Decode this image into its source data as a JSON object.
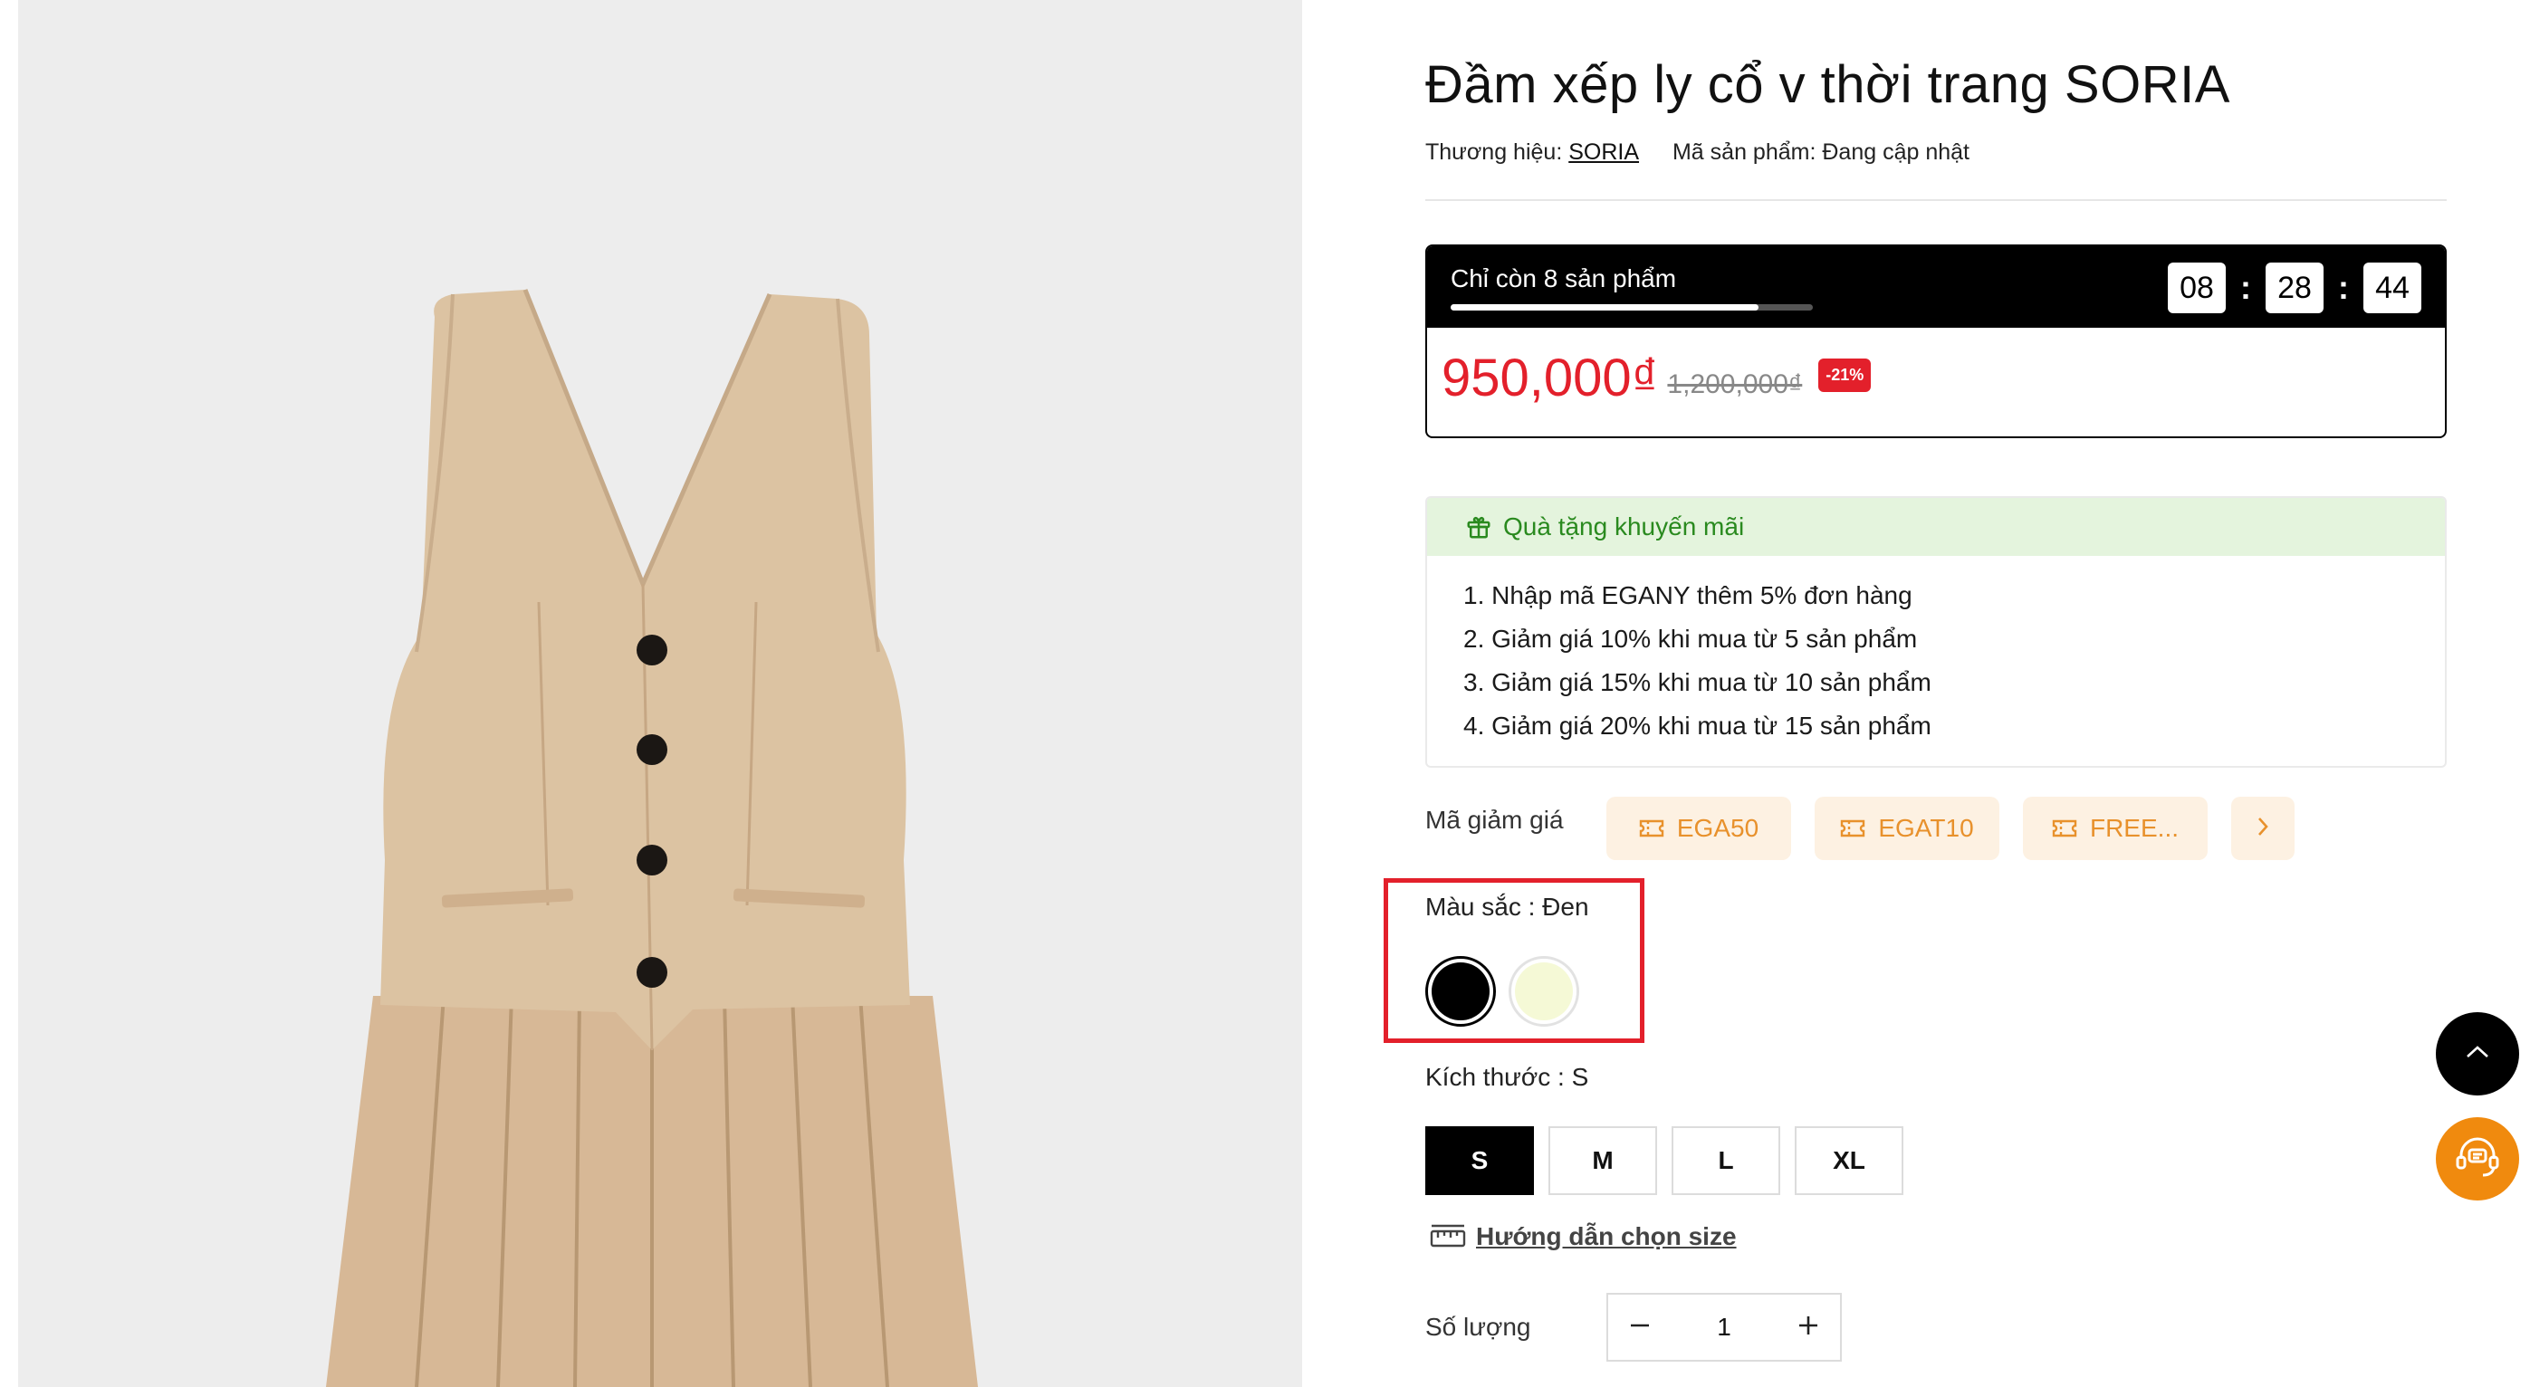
{
  "product": {
    "title": "Đầm xếp ly cổ v thời trang SORIA",
    "brand_label": "Thương hiệu:",
    "brand": "SORIA",
    "sku_label": "Mã sản phẩm:",
    "sku": "Đang cập nhật",
    "image_alt_icon": "dress-image"
  },
  "flash_sale": {
    "stock_text": "Chỉ còn 8 sản phẩm",
    "stock_fill_fraction": 0.85,
    "timer": {
      "hours": "08",
      "minutes": "28",
      "seconds": "44",
      "separator": ":"
    },
    "price": "950,000₫",
    "old_price": "1,200,000₫",
    "discount": "-21%",
    "price_color": "#e3202b"
  },
  "promo": {
    "title": "Quà tặng khuyến mãi",
    "icon": "gift-icon",
    "items": [
      "1. Nhập mã EGANY thêm 5% đơn hàng",
      "2. Giảm giá 10% khi mua từ 5 sản phẩm",
      "3. Giảm giá 15% khi mua từ 10 sản phẩm",
      "4. Giảm giá 20% khi mua từ 15 sản phẩm"
    ]
  },
  "coupons": {
    "label": "Mã giảm giá",
    "codes": [
      "EGA50",
      "EGAT10",
      "FREE..."
    ],
    "icon": "ticket-icon",
    "next_icon": "chevron-right-icon"
  },
  "color": {
    "label": "Màu sắc : Đen",
    "options": [
      {
        "name": "Đen",
        "hex": "#000000",
        "selected": true
      },
      {
        "name": "Kem",
        "hex": "#f5f9d6",
        "selected": false
      }
    ]
  },
  "size": {
    "label": "Kích thước : S",
    "options": [
      "S",
      "M",
      "L",
      "XL"
    ],
    "selected": "S"
  },
  "size_guide": {
    "label": "Hướng dẫn chọn size",
    "icon": "ruler-icon"
  },
  "quantity": {
    "label": "Số lượng",
    "value": "1"
  },
  "floating": {
    "scroll_top_icon": "chevron-up-icon",
    "support_icon": "support-chat-icon"
  },
  "colors": {
    "accent_red": "#e3202b",
    "promo_green": "#2a8a1f",
    "coupon_orange": "#e8912c",
    "support_orange": "#f08a0e"
  }
}
